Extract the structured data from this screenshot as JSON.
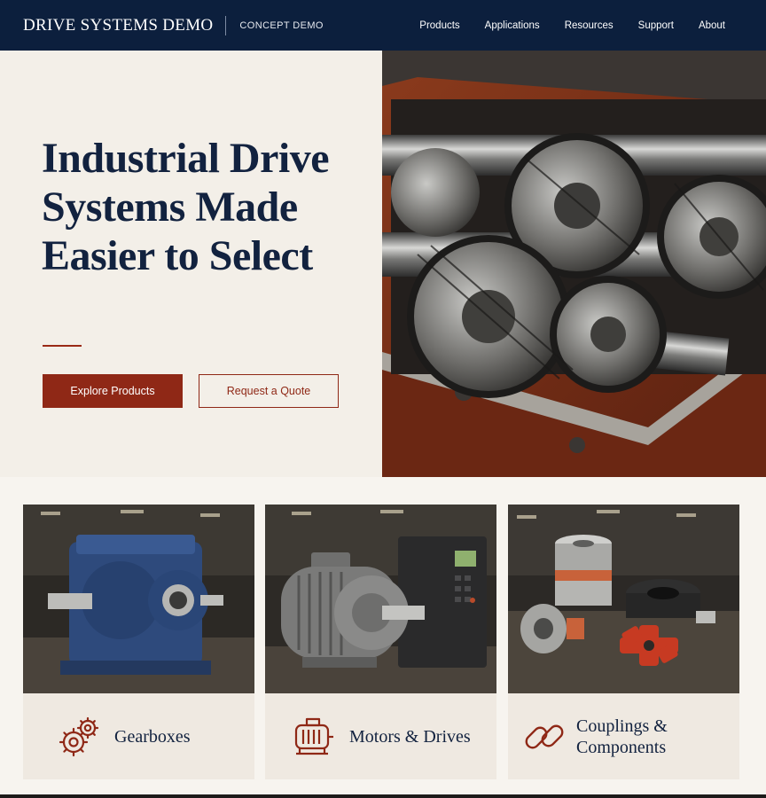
{
  "header": {
    "brand": "DRIVE SYSTEMS DEMO",
    "tagline": "CONCEPT DEMO",
    "nav": [
      "Products",
      "Applications",
      "Resources",
      "Support",
      "About"
    ]
  },
  "hero": {
    "title": "Industrial Drive Systems Made Easier to Select",
    "primary_button": "Explore Products",
    "secondary_button": "Request a Quote",
    "image": "gearbox-internals-photo"
  },
  "categories": [
    {
      "label": "Gearboxes",
      "icon": "gears-icon",
      "image": "blue-gearbox-photo"
    },
    {
      "label": "Motors & Drives",
      "icon": "motor-icon",
      "image": "motor-and-drive-photo"
    },
    {
      "label": "Couplings & Components",
      "icon": "chain-link-icon",
      "image": "couplings-photo"
    }
  ],
  "colors": {
    "navy": "#0c1f3d",
    "accent_red": "#8f2816",
    "hero_background": "#f3efe8",
    "card_background": "#efe9e1"
  }
}
